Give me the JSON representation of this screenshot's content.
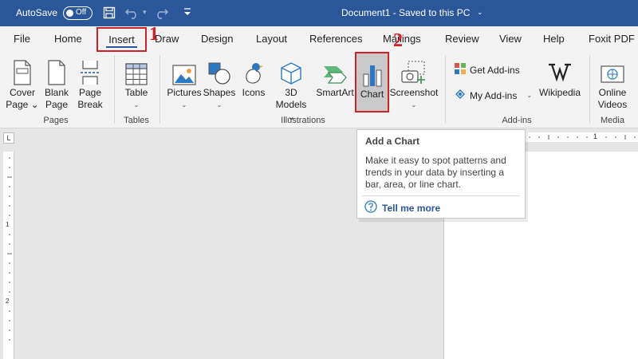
{
  "titlebar": {
    "autosave_label": "AutoSave",
    "autosave_state": "Off",
    "document_title": "Document1  -  Saved to this PC",
    "title_chevron": "⌄",
    "save_icon": "save-icon",
    "undo_icon": "undo-icon",
    "redo_icon": "redo-icon",
    "qat_icon": "customize-quick-access-icon"
  },
  "tabs": [
    "File",
    "Home",
    "Insert",
    "Draw",
    "Design",
    "Layout",
    "References",
    "Mailings",
    "Review",
    "View",
    "Help",
    "Foxit PDF"
  ],
  "markers": {
    "one": "1",
    "two": "2"
  },
  "ribbon": {
    "pages": {
      "label": "Pages",
      "cover": [
        "Cover",
        "Page ⌄"
      ],
      "blank": [
        "Blank",
        "Page"
      ],
      "break": [
        "Page",
        "Break"
      ]
    },
    "tables": {
      "label": "Tables",
      "table": [
        "Table",
        "⌄"
      ]
    },
    "illustrations": {
      "label": "Illustrations",
      "pictures": [
        "Pictures",
        "⌄"
      ],
      "shapes": [
        "Shapes",
        "⌄"
      ],
      "icons": [
        "Icons"
      ],
      "models": [
        "3D",
        "Models ⌄"
      ],
      "smartart": [
        "SmartArt"
      ],
      "chart": [
        "Chart"
      ],
      "screenshot": [
        "Screenshot",
        "⌄"
      ]
    },
    "addins": {
      "label": "Add-ins",
      "get": "Get Add-ins",
      "my": "My Add-ins",
      "my_caret": "⌄",
      "wikipedia": "Wikipedia"
    },
    "media": {
      "label": "Media",
      "online_videos": [
        "Online",
        "Videos"
      ]
    }
  },
  "ruler": {
    "corner": "L",
    "h_mark": "1",
    "v_marks": [
      "1",
      "2"
    ]
  },
  "tooltip": {
    "title": "Add a Chart",
    "body": [
      "Make it easy to spot patterns and",
      "trends in your data by inserting a",
      "bar, area, or line chart."
    ],
    "link": "Tell me more"
  },
  "colors": {
    "titlebar": "#2b579a",
    "ribbon": "#f3f3f3",
    "highlight": "#d11f2c",
    "workspace": "#e6e6e6"
  }
}
